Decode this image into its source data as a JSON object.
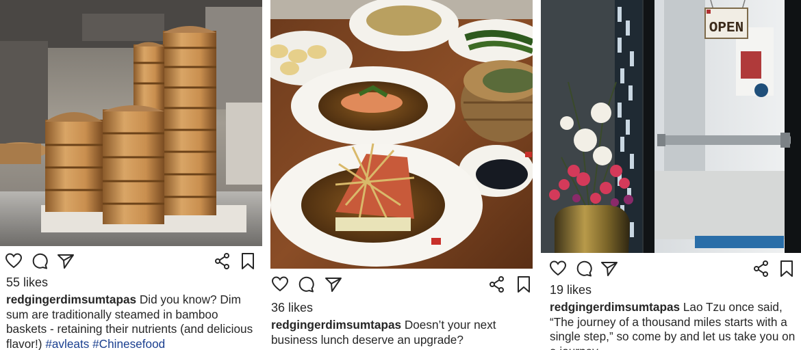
{
  "posts": [
    {
      "photo_subject": "Stacked bamboo dim sum steamer baskets on a steel kitchen counter",
      "likes": "55 likes",
      "username": "redgingerdimsumtapas",
      "caption": " Did you know? Dim sum are traditionally steamed in bamboo baskets - retaining their nutrients (and delicious flavor!) ",
      "hashtags": [
        "#avleats",
        "#Chinesefood"
      ],
      "icons": [
        "heart-icon",
        "comment-icon",
        "send-icon",
        "share-icon",
        "bookmark-icon"
      ]
    },
    {
      "photo_subject": "Plated seafood dishes with sauces on a wooden restaurant table",
      "likes": "36 likes",
      "username": "redgingerdimsumtapas",
      "caption": " Doesn’t your next business lunch deserve an upgrade?",
      "icons": [
        "heart-icon",
        "comment-icon",
        "send-icon",
        "share-icon",
        "bookmark-icon"
      ]
    },
    {
      "photo_subject": "Restaurant glass entrance door with hanging OPEN sign and floral arrangement",
      "door_sign": "OPEN",
      "likes": "19 likes",
      "username": "redgingerdimsumtapas",
      "caption": " Lao Tzu once said, “The journey of a thousand miles starts with a single step,” so come by and let us take you on a journey.",
      "icons": [
        "heart-icon",
        "comment-icon",
        "send-icon",
        "share-icon",
        "bookmark-icon"
      ]
    }
  ],
  "colors": {
    "text": "#262626",
    "hashtag": "#1a3f8f",
    "background": "#ffffff"
  }
}
